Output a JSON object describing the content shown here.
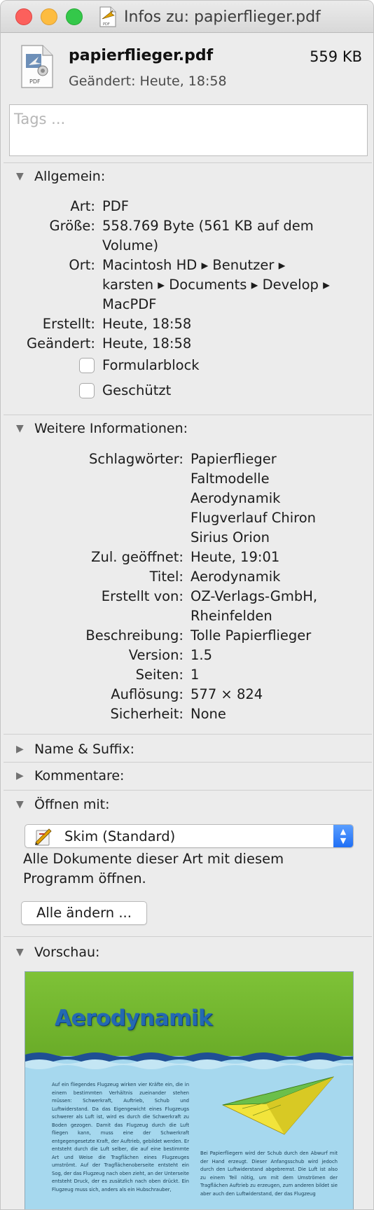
{
  "window": {
    "title": "Infos zu: papierflieger.pdf"
  },
  "header": {
    "file_name": "papierflieger.pdf",
    "file_size": "559 KB",
    "modified": "Geändert: Heute, 18:58",
    "icon_label": "PDF",
    "tags_placeholder": "Tags ..."
  },
  "general": {
    "title": "Allgemein:",
    "rows": [
      {
        "label": "Art:",
        "lines": [
          "PDF"
        ]
      },
      {
        "label": "Größe:",
        "lines": [
          "558.769 Byte (561 KB auf dem",
          "Volume)"
        ]
      },
      {
        "label": "Ort:",
        "lines": [
          "Macintosh HD ▸ Benutzer ▸",
          "karsten ▸ Documents ▸ Develop ▸",
          "MacPDF"
        ]
      },
      {
        "label": "Erstellt:",
        "lines": [
          "Heute, 18:58"
        ]
      },
      {
        "label": "Geändert:",
        "lines": [
          "Heute, 18:58"
        ]
      }
    ],
    "checkbox_stationery": {
      "label": "Formularblock",
      "checked": false
    },
    "checkbox_locked": {
      "label": "Geschützt",
      "checked": false
    }
  },
  "more_info": {
    "title": "Weitere Informationen:",
    "rows": [
      {
        "label": "Schlagwörter:",
        "lines": [
          "Papierflieger",
          "Faltmodelle",
          "Aerodynamik",
          "Flugverlauf Chiron",
          "Sirius Orion"
        ]
      },
      {
        "label": "Zul. geöffnet:",
        "lines": [
          "Heute, 19:01"
        ]
      },
      {
        "label": "Titel:",
        "lines": [
          "Aerodynamik"
        ]
      },
      {
        "label": "Erstellt von:",
        "lines": [
          "OZ-Verlags-GmbH,",
          "Rheinfelden"
        ]
      },
      {
        "label": "Beschreibung:",
        "lines": [
          "Tolle Papierflieger"
        ]
      },
      {
        "label": "Version:",
        "lines": [
          "1.5"
        ]
      },
      {
        "label": "Seiten:",
        "lines": [
          "1"
        ]
      },
      {
        "label": "Auflösung:",
        "lines": [
          "577 × 824"
        ]
      },
      {
        "label": "Sicherheit:",
        "lines": [
          "None"
        ]
      }
    ]
  },
  "name_suffix": {
    "title": "Name & Suffix:"
  },
  "comments": {
    "title": "Kommentare:"
  },
  "open_with": {
    "title": "Öffnen mit:",
    "selected_app": "Skim (Standard)",
    "hint_line_1": "Alle Dokumente dieser Art mit diesem",
    "hint_line_2": "Programm öffnen.",
    "change_all_label": "Alle ändern ..."
  },
  "preview": {
    "title": "Vorschau:",
    "page_heading": "Aerodynamik",
    "col_left": "Auf ein fliegendes Flugzeug wirken vier Kräfte ein, die in einem bestimmten Verhältnis zueinander stehen müssen: Schwerkraft, Auftrieb, Schub und Luftwiderstand. Da das Eigengewicht eines Flugzeugs schwerer als Luft ist, wird es durch die Schwerkraft zu Boden gezogen. Damit das Flugzeug durch die Luft fliegen kann, muss eine der Schwerkraft entgegengesetzte Kraft, der Auftrieb, gebildet werden. Er entsteht durch die Luft selber, die auf eine bestimmte Art und Weise die Tragflächen eines Flugzeuges umströmt. Auf der Tragflächenoberseite entsteht ein Sog, der das Flugzeug nach oben zieht, an der Unterseite entsteht Druck, der es zusätzlich nach oben drückt. Ein Flugzeug muss sich, anders als ein Hubschrauber,",
    "col_right": "Bei Papierfliegern wird der Schub durch den Abwurf mit der Hand erzeugt. Dieser Anfangsschub wird jedoch durch den Luftwiderstand abgebremst. Die Luft ist also zu einem Teil nötig, um mit dem Umströmen der Tragflächen Auftrieb zu erzeugen, zum anderen bildet sie aber auch den Luftwiderstand, der das Flugzeug"
  },
  "colors": {
    "close": "#fc605c",
    "minimize": "#fdbc40",
    "zoom": "#34c84a",
    "preview_green": "#76b52e",
    "preview_blue": "#9fd4ec",
    "accent": "#1f6ff5"
  }
}
